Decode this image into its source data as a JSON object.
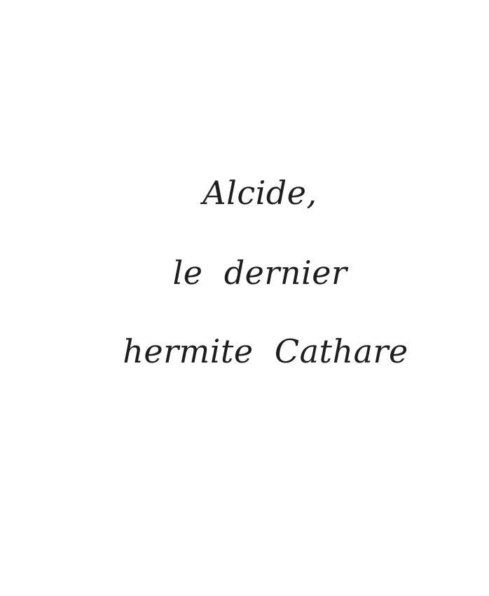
{
  "title": {
    "lines": [
      "Alcide,",
      "le  dernier",
      "hermite  Cathare"
    ]
  },
  "colors": {
    "background": "#ffffff",
    "text": "#1e1e1e"
  }
}
